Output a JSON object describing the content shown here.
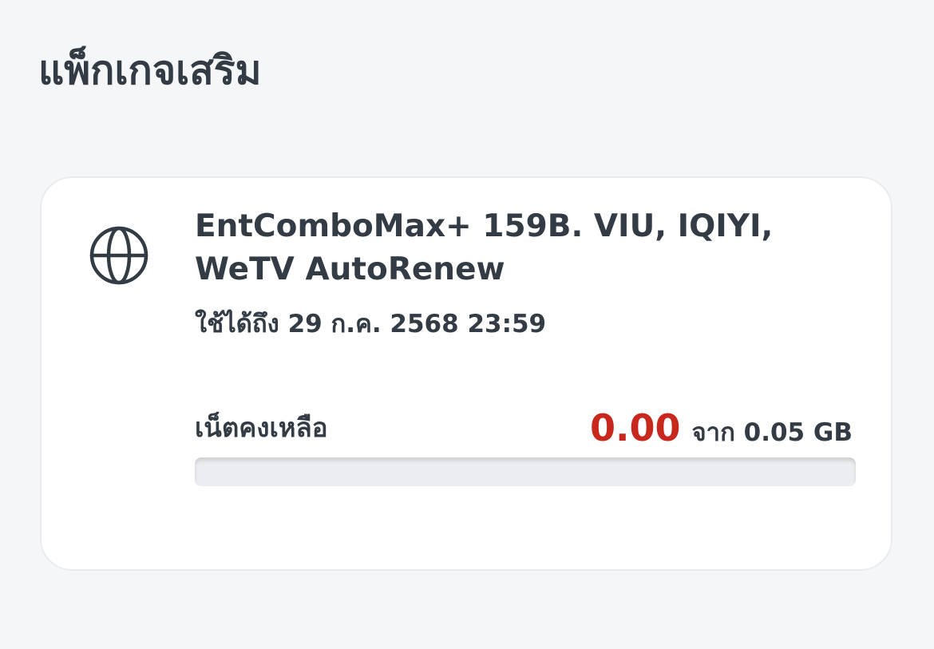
{
  "header": {
    "title": "แพ็กเกจเสริม"
  },
  "package": {
    "icon": "globe-icon",
    "name": "EntComboMax+ 159B. VIU, IQIYI, WeTV AutoRenew",
    "expiry": "ใช้ได้ถึง 29 ก.ค. 2568 23:59",
    "remaining_label": "เน็ตคงเหลือ",
    "remaining_amount": "0.00",
    "remaining_total": "จาก 0.05 GB",
    "usage_progress_remaining_fraction": 0,
    "colors": {
      "remaining_amount": "#c8271d",
      "track": "#ebedf0"
    }
  }
}
